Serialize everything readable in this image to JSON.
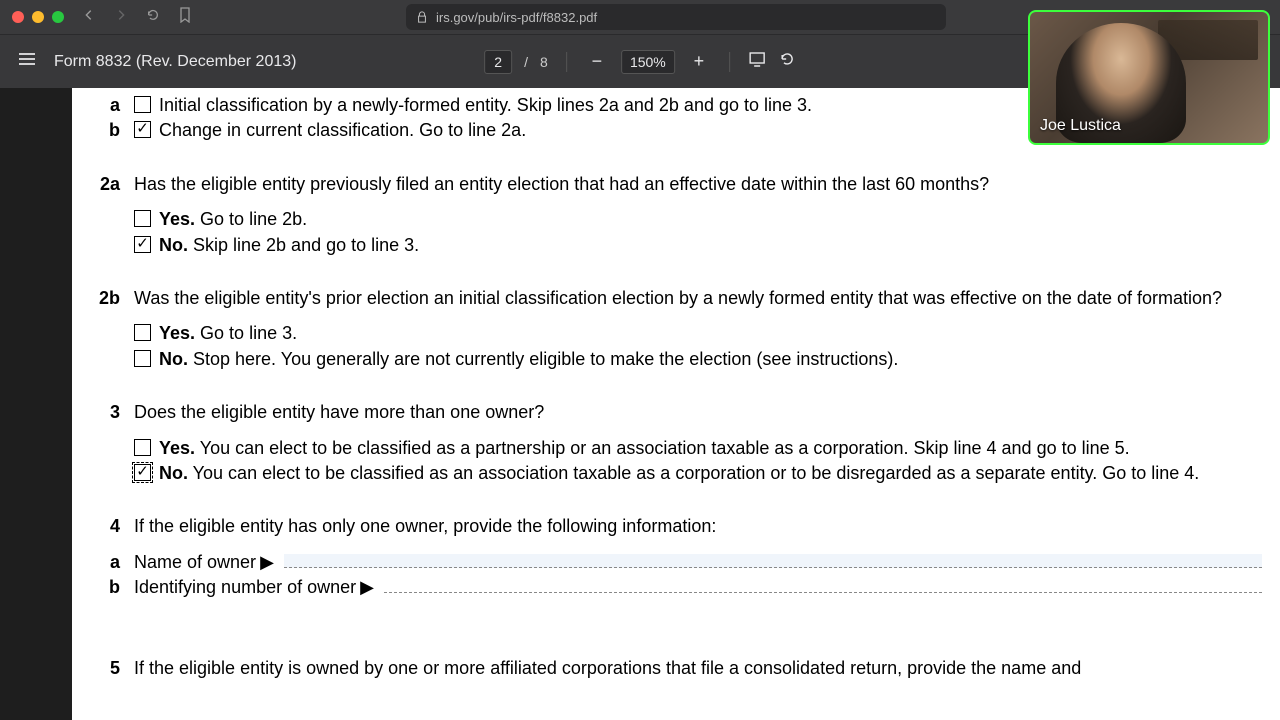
{
  "browser": {
    "url": "irs.gov/pub/irs-pdf/f8832.pdf"
  },
  "pdf_toolbar": {
    "title": "Form 8832 (Rev. December 2013)",
    "page_current": "2",
    "page_sep": "/",
    "page_total": "8",
    "zoom": "150%",
    "zoom_out": "−",
    "zoom_in": "+"
  },
  "form": {
    "l1a": {
      "sub": "a",
      "text": "Initial classification by a newly-formed entity. Skip lines 2a and 2b and go to line 3."
    },
    "l1b": {
      "sub": "b",
      "text": "Change in current classification. Go to line 2a."
    },
    "l2a": {
      "num": "2a",
      "q": "Has the eligible entity previously filed an entity election that had an effective date within the last 60 months?",
      "yes_b": "Yes.",
      "yes_t": " Go to line 2b.",
      "no_b": "No.",
      "no_t": " Skip line 2b and go to line 3."
    },
    "l2b": {
      "num": "2b",
      "q": "Was the eligible entity's prior election an initial classification election by a newly formed entity that was effective on the date of formation?",
      "yes_b": "Yes.",
      "yes_t": " Go to line 3.",
      "no_b": "No.",
      "no_t": " Stop here. You generally are not currently eligible to make the election (see instructions)."
    },
    "l3": {
      "num": "3",
      "q": "Does the eligible entity have more than one owner?",
      "yes_b": "Yes.",
      "yes_t": " You can elect to be classified as a partnership or an association taxable as a corporation. Skip line 4 and go to line 5.",
      "no_b": "No.",
      "no_t": " You can elect to be classified as an association taxable as a corporation or to be disregarded as a separate entity. Go to  line 4."
    },
    "l4": {
      "num": "4",
      "q": "If the eligible entity has only one owner, provide the following information:",
      "a_sub": "a",
      "a_label": "Name of owner ",
      "a_arrow": "▶",
      "b_sub": "b",
      "b_label": "Identifying number of owner ",
      "b_arrow": "▶"
    },
    "l5": {
      "num": "5",
      "q": "If the eligible entity is owned by one or more affiliated corporations that file a consolidated return, provide the name and"
    }
  },
  "webcam": {
    "name": "Joe Lustica"
  }
}
